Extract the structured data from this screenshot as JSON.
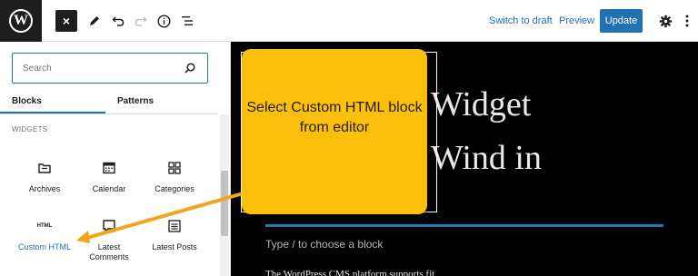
{
  "toolbar": {
    "logo_letter": "W",
    "close_glyph": "×",
    "switch_to_draft": "Switch to draft",
    "preview": "Preview",
    "update": "Update"
  },
  "inserter": {
    "search_placeholder": "Search",
    "tabs": [
      "Blocks",
      "Patterns"
    ],
    "section_title": "WIDGETS",
    "blocks": [
      {
        "label": "Archives",
        "icon": "archive-icon"
      },
      {
        "label": "Calendar",
        "icon": "calendar-icon"
      },
      {
        "label": "Categories",
        "icon": "categories-icon"
      },
      {
        "label": "Custom HTML",
        "icon": "html-icon",
        "icon_text": "HTML",
        "selected": true
      },
      {
        "label": "Latest Comments",
        "icon": "comment-icon"
      },
      {
        "label": "Latest Posts",
        "icon": "posts-list-icon"
      }
    ]
  },
  "editor": {
    "heading_fragment_1": "Widget",
    "heading_fragment_2": "Wind in",
    "block_placeholder": "Type / to choose a block",
    "paragraph_fragment": "The WordPress CMS platform supports fit"
  },
  "callout": {
    "text": "Select Custom HTML block from editor",
    "color": "#fbbf0c",
    "arrow_color": "#f5a31a"
  },
  "colors": {
    "accent": "#2271b1",
    "canvas_bg": "#000000",
    "rule": "#1b7bb5"
  }
}
